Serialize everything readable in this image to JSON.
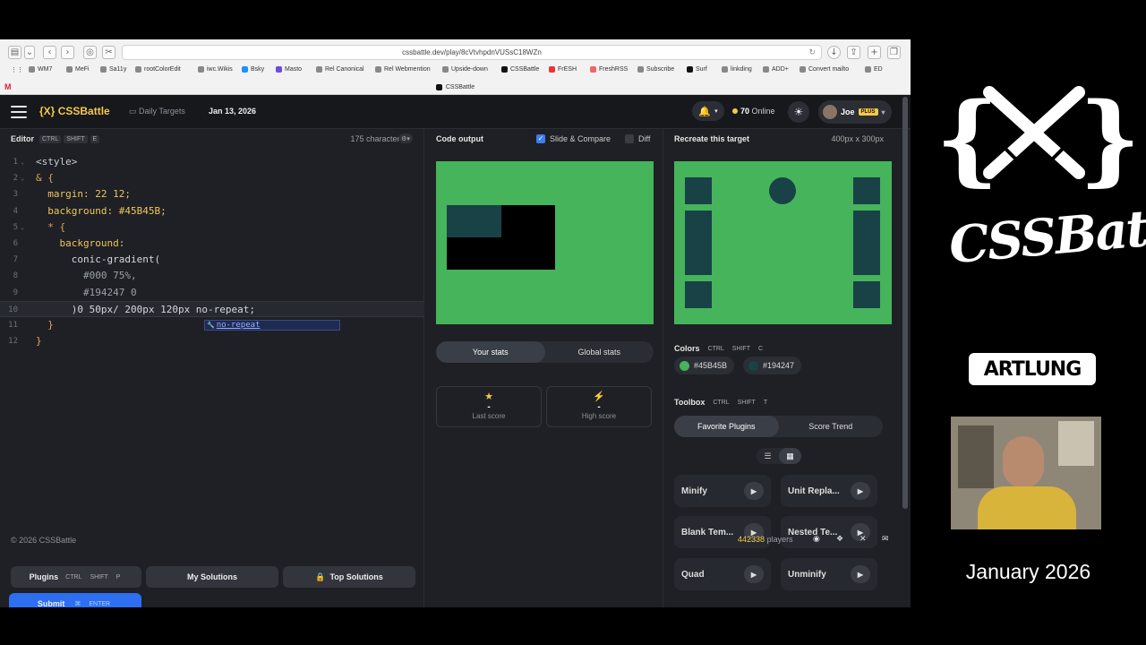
{
  "browser": {
    "url": "cssbattle.dev/play/8cVtvhpdnVUSsC18WZn",
    "bookmarks": [
      "WM7",
      "MeFi",
      "Sa11y",
      "rootColorEdit",
      "iwc.Wikis",
      "Bsky",
      "Masto",
      "Rel Canonical",
      "Rel Webmention",
      "Upside-down",
      "CSSBattle",
      "FrESH",
      "FreshRSS",
      "Subscribe",
      "Surf",
      "linkding",
      "ADD+",
      "Convert mailto",
      "ED"
    ],
    "tab_title": "CSSBattle"
  },
  "header": {
    "logo_mark": "{X}",
    "logo_text": "CSSBattle",
    "daily_label": "Daily Targets",
    "date": "Jan 13, 2026",
    "online_count": "70",
    "online_label": "Online",
    "user_name": "Joe",
    "plus_badge": "PLUS"
  },
  "editor": {
    "title": "Editor",
    "shortcut": [
      "CTRL",
      "SHIFT",
      "E"
    ],
    "char_count": "175 characters",
    "autocomplete": "no-repeat",
    "lines": [
      {
        "n": "1",
        "text": "<style>"
      },
      {
        "n": "2",
        "text": "& {"
      },
      {
        "n": "3",
        "text": "  margin: 22 12;"
      },
      {
        "n": "4",
        "text": "  background: #45B45B;"
      },
      {
        "n": "5",
        "text": "  * {"
      },
      {
        "n": "6",
        "text": "    background:"
      },
      {
        "n": "7",
        "text": "      conic-gradient("
      },
      {
        "n": "8",
        "text": "        #000 75%,"
      },
      {
        "n": "9",
        "text": "        #194247 0"
      },
      {
        "n": "10",
        "text": "      )0 50px/ 200px 120px no-repeat;"
      },
      {
        "n": "11",
        "text": "  }"
      },
      {
        "n": "12",
        "text": "}"
      }
    ]
  },
  "buttons": {
    "plugins": "Plugins",
    "plugins_shortcut": [
      "CTRL",
      "SHIFT",
      "P"
    ],
    "my_solutions": "My Solutions",
    "top_solutions": "Top Solutions",
    "submit": "Submit",
    "submit_shortcut": [
      "⌘",
      "ENTER"
    ]
  },
  "output": {
    "title": "Code output",
    "slide_compare": "Slide & Compare",
    "diff": "Diff",
    "stats_tabs": [
      "Your stats",
      "Global stats"
    ],
    "last_score_label": "Last score",
    "last_score_value": "-",
    "high_score_label": "High score",
    "high_score_value": "-"
  },
  "target": {
    "title": "Recreate this target",
    "size": "400px x 300px",
    "colors_label": "Colors",
    "colors_shortcut": [
      "CTRL",
      "SHIFT",
      "C"
    ],
    "colors": [
      {
        "hex": "#45B45B",
        "swatch": "#45b45b"
      },
      {
        "hex": "#194247",
        "swatch": "#194247"
      }
    ],
    "toolbox_label": "Toolbox",
    "toolbox_shortcut": [
      "CTRL",
      "SHIFT",
      "T"
    ],
    "toolbox_tabs": [
      "Favorite Plugins",
      "Score Trend"
    ],
    "plugins": [
      "Minify",
      "Unit Repla...",
      "Blank Tem...",
      "Nested Te...",
      "Quad",
      "Unminify"
    ]
  },
  "footer": {
    "copyright": "© 2026 CSSBattle",
    "players_count": "442338",
    "players_label": "players"
  },
  "side": {
    "month": "January 2026",
    "artlung": "ARTLUNG",
    "css_battle_text": "CSSBattle"
  },
  "colors": {
    "accent": "#f5c84c",
    "green": "#45b45b",
    "teal": "#194247",
    "submit_blue": "#2d6ff0"
  }
}
